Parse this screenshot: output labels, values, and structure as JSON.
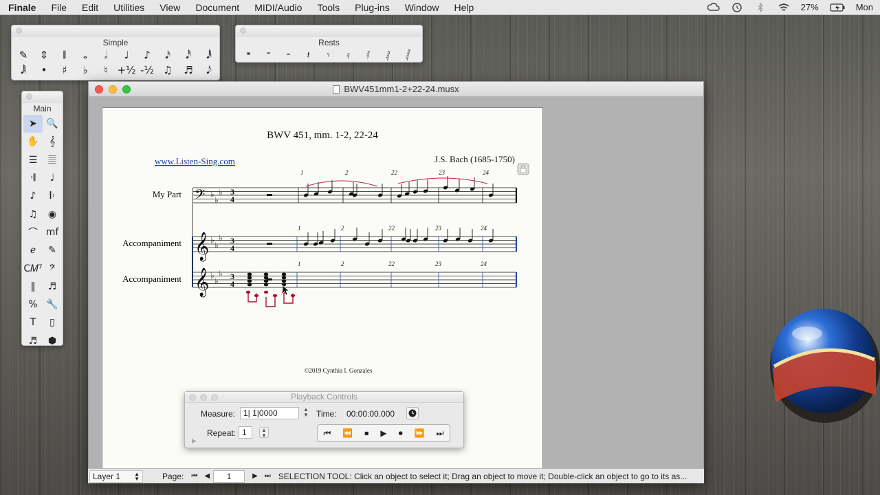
{
  "menubar": {
    "app_name": "Finale",
    "items": [
      "File",
      "Edit",
      "Utilities",
      "View",
      "Document",
      "MIDI/Audio",
      "Tools",
      "Plug-ins",
      "Window",
      "Help"
    ],
    "battery": "27%",
    "clock": "Mon"
  },
  "palettes": {
    "simple": {
      "title": "Simple",
      "row1": [
        "✎",
        "⇕",
        "𝄃",
        "𝅝",
        "𝅗𝅥",
        "♩",
        "♪",
        "𝅘𝅥𝅯",
        "𝅘𝅥𝅰",
        "𝅘𝅥𝅱"
      ],
      "row2": [
        "𝅘𝅥𝅲",
        "•",
        "♯",
        "♭",
        "♮",
        "+½",
        "-½",
        "♫",
        "♬",
        "𝅘𝅥𝅮"
      ]
    },
    "rests": {
      "title": "Rests",
      "items": [
        "𝄺",
        "𝄻",
        "𝄼",
        "𝄽",
        "𝄾",
        "𝄿",
        "𝅀",
        "𝅁",
        "𝅂"
      ]
    },
    "main": {
      "title": "Main",
      "tools": [
        "➤",
        "🔍",
        "✋",
        "𝄞",
        "☰",
        "𝄚",
        "𝄇",
        "♩",
        "♪",
        "𝄆",
        "♫",
        "◉",
        "⌒",
        "mf",
        "ℯ",
        "✎",
        "C𝑀⁷",
        "𝄢",
        "‖",
        "♬",
        "%",
        "🔧",
        "T",
        "▯",
        "♬",
        "⬢"
      ]
    }
  },
  "window": {
    "title": "BWV451mm1-2+22-24.musx"
  },
  "score": {
    "title": "BWV 451, mm. 1-2, 22-24",
    "website": "www.Listen-Sing.com",
    "composer": "J.S. Bach (1685-1750)",
    "copyright": "©2019 Cynthia I. Gonzales",
    "staff_names": [
      "My Part",
      "Accompaniment",
      "Accompaniment"
    ],
    "time_signature": "3/4",
    "measure_numbers": [
      "1",
      "2",
      "22",
      "23",
      "24"
    ],
    "clefs": [
      "bass",
      "treble",
      "treble"
    ],
    "key_signature": "3 flats"
  },
  "playback": {
    "title": "Playback Controls",
    "measure_label": "Measure:",
    "measure_value": "1| 1|0000",
    "time_label": "Time:",
    "time_value": "00:00:00.000",
    "repeat_label": "Repeat:",
    "repeat_value": "1",
    "transport": [
      "⏮",
      "⏪",
      "⏹",
      "▶",
      "⏺",
      "⏩",
      "⏭"
    ]
  },
  "statusbar": {
    "layer": "Layer 1",
    "page_label": "Page:",
    "page_value": "1",
    "message": "SELECTION TOOL: Click an object to select it; Drag an object to move it; Double-click an object to go to its as..."
  }
}
